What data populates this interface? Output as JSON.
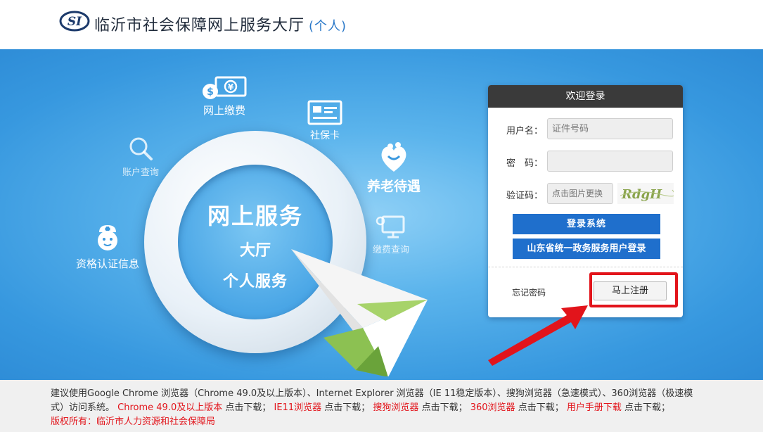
{
  "header": {
    "title": "临沂市社会保障网上服务大厅",
    "subtitle": "(个人)"
  },
  "banner": {
    "center_title": "网上服务",
    "center_line2": "大厅",
    "center_line3": "个人服务",
    "services": {
      "payment": "网上缴费",
      "card": "社保卡",
      "account": "账户查询",
      "pension": "养老待遇",
      "qualification": "资格认证信息",
      "pay_query": "缴费查询"
    }
  },
  "login": {
    "header": "欢迎登录",
    "username_label": "用户名：",
    "username_placeholder": "证件号码",
    "password_label": "密　码：",
    "captcha_label": "验证码：",
    "captcha_placeholder": "点击图片更换",
    "captcha_text": "RdgH",
    "login_button": "登录系统",
    "gov_login_button": "山东省统一政务服务用户登录",
    "forgot_password": "忘记密码",
    "register_button": "马上注册"
  },
  "footer": {
    "line1": "建议使用Google Chrome 浏览器（Chrome 49.0及以上版本）、Internet Explorer 浏览器（IE 11稳定版本）、搜狗浏览器（急速模式）、360浏览器（极速模",
    "line2_prefix": "式）访问系统。",
    "downloads": [
      {
        "name": "Chrome 49.0及以上版本",
        "suffix": "点击下载；"
      },
      {
        "name": "IE11浏览器",
        "suffix": "点击下载；"
      },
      {
        "name": "搜狗浏览器",
        "suffix": "点击下载；"
      },
      {
        "name": "360浏览器",
        "suffix": "点击下载；"
      },
      {
        "name": "用户手册下载",
        "suffix": "点击下载；"
      }
    ],
    "copyright": "版权所有：临沂市人力资源和社会保障局"
  },
  "colors": {
    "accent_blue": "#1f6fcc",
    "highlight_red": "#e2141b",
    "banner_blue": "#3798df"
  },
  "icons": {
    "logo": "si-logo",
    "payment": "money-icon",
    "card": "card-icon",
    "account": "search-icon",
    "pension": "heart-people-icon",
    "qualification": "nurse-icon",
    "pay_query": "monitor-icon"
  }
}
